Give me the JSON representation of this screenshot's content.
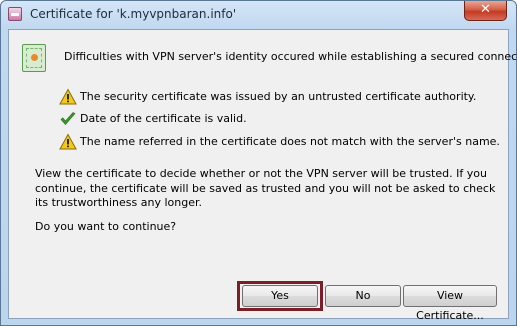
{
  "window": {
    "title": "Certificate for 'k.myvpnbaran.info'",
    "close_glyph": "✕"
  },
  "dialog": {
    "headline": "Difficulties with VPN server's identity occured while establishing a secured connection:",
    "checks": [
      {
        "status": "warning",
        "icon": "warning-triangle-icon",
        "text": "The security certificate was issued by an untrusted certificate authority."
      },
      {
        "status": "ok",
        "icon": "green-checkmark-icon",
        "text": "Date of the certificate is valid."
      },
      {
        "status": "warning",
        "icon": "warning-triangle-icon",
        "text": "The name referred in the certificate does not match with the server's name."
      }
    ],
    "explanation": "View the certificate to decide whether or not the VPN server will be trusted. If you continue, the certificate will be saved as trusted and you will not be asked to check its trustworthiness any longer.",
    "question": "Do you want to continue?"
  },
  "buttons": {
    "yes": "Yes",
    "no": "No",
    "view_certificate": "View Certificate..."
  },
  "colors": {
    "warning": "#f2c81e",
    "ok": "#3a9a2a",
    "focus_ring": "#7b1e2a"
  }
}
